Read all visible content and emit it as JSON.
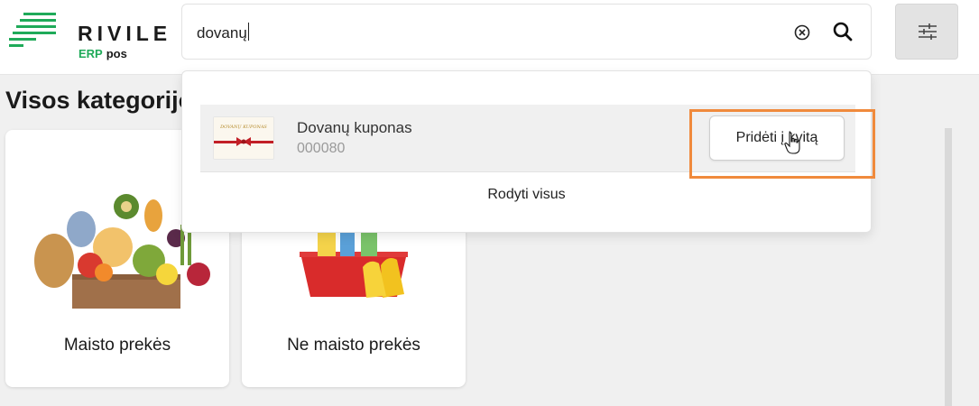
{
  "brand": {
    "name": "RIVILE",
    "sub_erp": "ERP",
    "sub_pos": "pos",
    "accent": "#1faa59"
  },
  "search": {
    "value": "dovanų",
    "clear_icon": "clear-circle-icon",
    "search_icon": "search-icon"
  },
  "toolbar": {
    "filter_icon": "sliders-icon"
  },
  "section": {
    "title": "Visos kategorijos"
  },
  "categories": [
    {
      "label": "Maisto prekės",
      "image": "groceries-image"
    },
    {
      "label": "Ne maisto prekės",
      "image": "cleaning-supplies-image"
    }
  ],
  "dropdown": {
    "results": [
      {
        "name": "Dovanų kuponas",
        "code": "000080",
        "button": "Pridėti į kvitą",
        "thumb_text": "DOVANŲ KUPONAS"
      }
    ],
    "show_all": "Rodyti visus"
  },
  "annotation": {
    "color": "#f08a3c"
  }
}
